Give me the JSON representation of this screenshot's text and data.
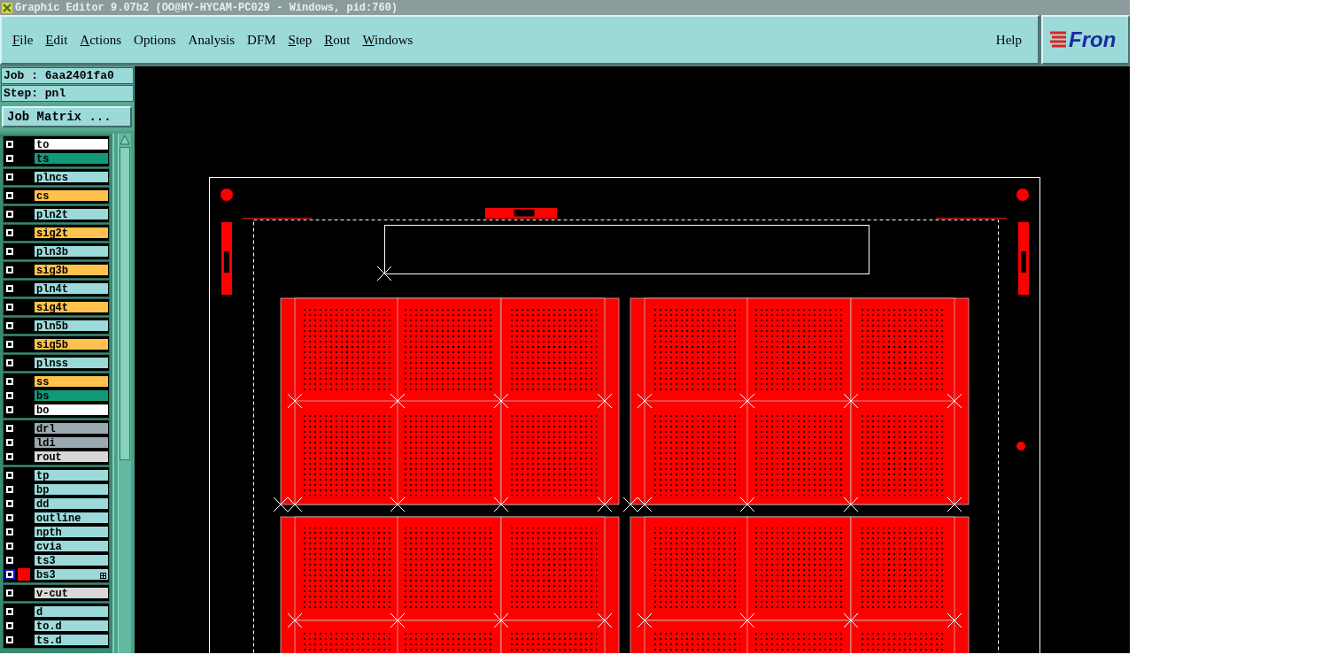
{
  "window": {
    "title": "Graphic Editor 9.07b2 (OO@HY-HYCAM-PC029 - Windows, pid:760)"
  },
  "menu": [
    {
      "label": "File",
      "mnemonic": true
    },
    {
      "label": "Edit",
      "mnemonic": true
    },
    {
      "label": "Actions",
      "mnemonic": true
    },
    {
      "label": "Options",
      "mnemonic": false
    },
    {
      "label": "Analysis",
      "mnemonic": false
    },
    {
      "label": "DFM",
      "mnemonic": false
    },
    {
      "label": "Step",
      "mnemonic": true
    },
    {
      "label": "Rout",
      "mnemonic": true
    },
    {
      "label": "Windows",
      "mnemonic": true
    }
  ],
  "help": {
    "label": "Help"
  },
  "logo": {
    "text": "Fron"
  },
  "job": "Job : 6aa2401fa0",
  "step": "Step: pnl",
  "job_matrix_button": "Job Matrix ...",
  "layer_groups": [
    [
      {
        "name": "to",
        "color": "#ffffff",
        "checked": false,
        "active": false
      },
      {
        "name": "ts",
        "color": "#119a78",
        "checked": false,
        "active": false
      }
    ],
    [
      {
        "name": "plncs",
        "color": "#9cdada",
        "checked": false,
        "active": false
      }
    ],
    [
      {
        "name": "cs",
        "color": "#ffc24c",
        "checked": false,
        "active": false
      }
    ],
    [
      {
        "name": "pln2t",
        "color": "#9cdada",
        "checked": false,
        "active": false
      }
    ],
    [
      {
        "name": "sig2t",
        "color": "#ffc24c",
        "checked": false,
        "active": false
      }
    ],
    [
      {
        "name": "pln3b",
        "color": "#9cdada",
        "checked": false,
        "active": false
      }
    ],
    [
      {
        "name": "sig3b",
        "color": "#ffc24c",
        "checked": false,
        "active": false
      }
    ],
    [
      {
        "name": "pln4t",
        "color": "#9cdada",
        "checked": false,
        "active": false
      }
    ],
    [
      {
        "name": "sig4t",
        "color": "#ffc24c",
        "checked": false,
        "active": false
      }
    ],
    [
      {
        "name": "pln5b",
        "color": "#9cdada",
        "checked": false,
        "active": false
      }
    ],
    [
      {
        "name": "sig5b",
        "color": "#ffc24c",
        "checked": false,
        "active": false
      }
    ],
    [
      {
        "name": "plnss",
        "color": "#9cdada",
        "checked": false,
        "active": false
      }
    ],
    [
      {
        "name": "ss",
        "color": "#ffc24c",
        "checked": false,
        "active": false
      },
      {
        "name": "bs",
        "color": "#119a78",
        "checked": false,
        "active": false
      },
      {
        "name": "bo",
        "color": "#ffffff",
        "checked": false,
        "active": false
      }
    ],
    [
      {
        "name": "drl",
        "color": "#9aaab0",
        "checked": false,
        "active": false
      },
      {
        "name": "ldi",
        "color": "#9aaab0",
        "checked": false,
        "active": false
      },
      {
        "name": "rout",
        "color": "#d8d8d8",
        "checked": false,
        "active": false
      }
    ],
    [
      {
        "name": "tp",
        "color": "#9cdada",
        "checked": false,
        "active": false
      },
      {
        "name": "bp",
        "color": "#9cdada",
        "checked": false,
        "active": false
      },
      {
        "name": "dd",
        "color": "#9cdada",
        "checked": false,
        "active": false
      },
      {
        "name": "outline",
        "color": "#9cdada",
        "checked": false,
        "active": false
      },
      {
        "name": "npth",
        "color": "#9cdada",
        "checked": false,
        "active": false
      },
      {
        "name": "cvia",
        "color": "#9cdada",
        "checked": false,
        "active": false
      },
      {
        "name": "ts3",
        "color": "#9cdada",
        "checked": false,
        "active": false
      },
      {
        "name": "bs3",
        "color": "#9cdada",
        "checked": false,
        "active": true
      }
    ],
    [
      {
        "name": "v-cut",
        "color": "#d8d8d8",
        "checked": false,
        "active": false
      }
    ],
    [
      {
        "name": "d",
        "color": "#9cdada",
        "checked": false,
        "active": false
      },
      {
        "name": "to.d",
        "color": "#9cdada",
        "checked": false,
        "active": false
      },
      {
        "name": "ts.d",
        "color": "#9cdada",
        "checked": false,
        "active": false
      }
    ]
  ]
}
